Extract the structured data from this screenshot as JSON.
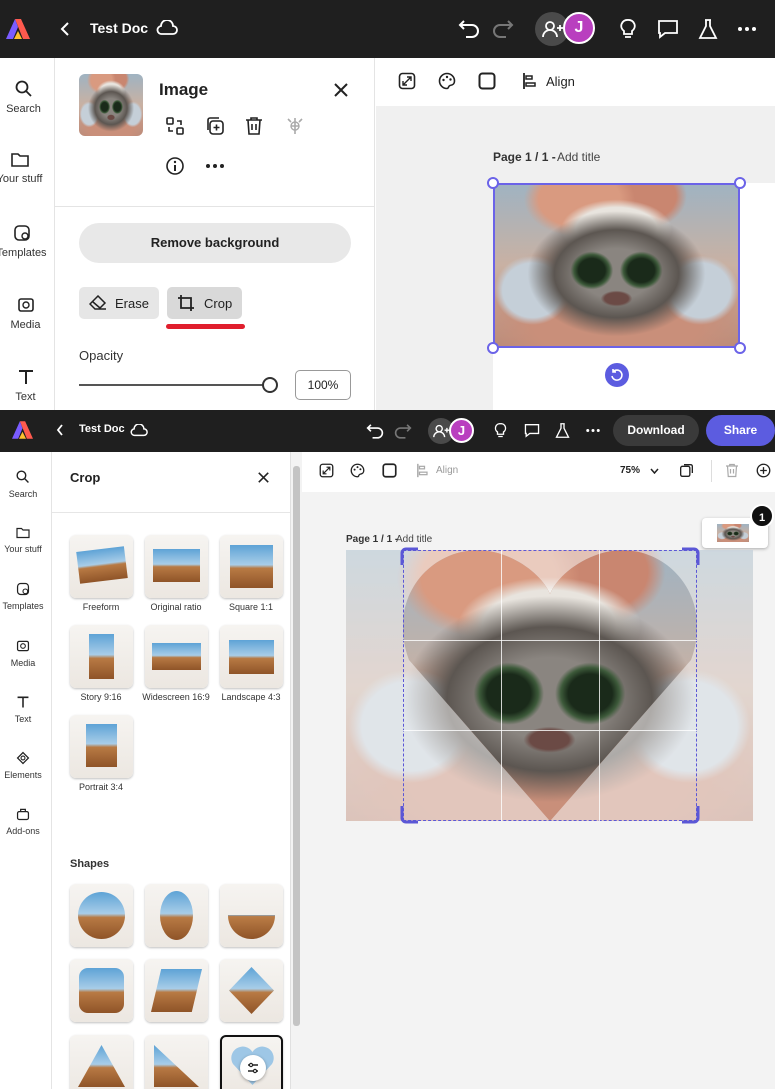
{
  "top": {
    "header": {
      "doc_title": "Test Doc",
      "avatar_initial": "J"
    },
    "rail": [
      {
        "label": "Search"
      },
      {
        "label": "Your stuff"
      },
      {
        "label": "Templates"
      },
      {
        "label": "Media"
      },
      {
        "label": "Text"
      }
    ],
    "panel": {
      "title": "Image",
      "remove_bg_label": "Remove background",
      "erase_label": "Erase",
      "crop_label": "Crop",
      "opacity_label": "Opacity",
      "opacity_value": "100%",
      "opacity_level": 1.0
    },
    "canvas": {
      "align_label": "Align",
      "page_label": "Page 1 / 1 -",
      "add_title": "Add title"
    }
  },
  "bottom": {
    "header": {
      "doc_title": "Test Doc",
      "avatar_initial": "J",
      "download_label": "Download",
      "share_label": "Share"
    },
    "rail": [
      {
        "label": "Search"
      },
      {
        "label": "Your stuff"
      },
      {
        "label": "Templates"
      },
      {
        "label": "Media"
      },
      {
        "label": "Text"
      },
      {
        "label": "Elements"
      },
      {
        "label": "Add-ons"
      }
    ],
    "crop_panel": {
      "title": "Crop",
      "options": [
        {
          "label": "Freeform"
        },
        {
          "label": "Original ratio"
        },
        {
          "label": "Square 1:1"
        },
        {
          "label": "Story 9:16"
        },
        {
          "label": "Widescreen 16:9"
        },
        {
          "label": "Landscape 4:3"
        },
        {
          "label": "Portrait 3:4"
        }
      ],
      "shapes_label": "Shapes"
    },
    "canvas": {
      "align_label": "Align",
      "zoom_label": "75%",
      "page_label": "Page 1 / 1 -",
      "add_title": "Add title",
      "page_count_badge": "1"
    }
  },
  "colors": {
    "header_bg": "#1f1f1f",
    "accent": "#5c5ce0",
    "avatar": "#b93fbf",
    "annotation_red": "#e01e2d"
  }
}
